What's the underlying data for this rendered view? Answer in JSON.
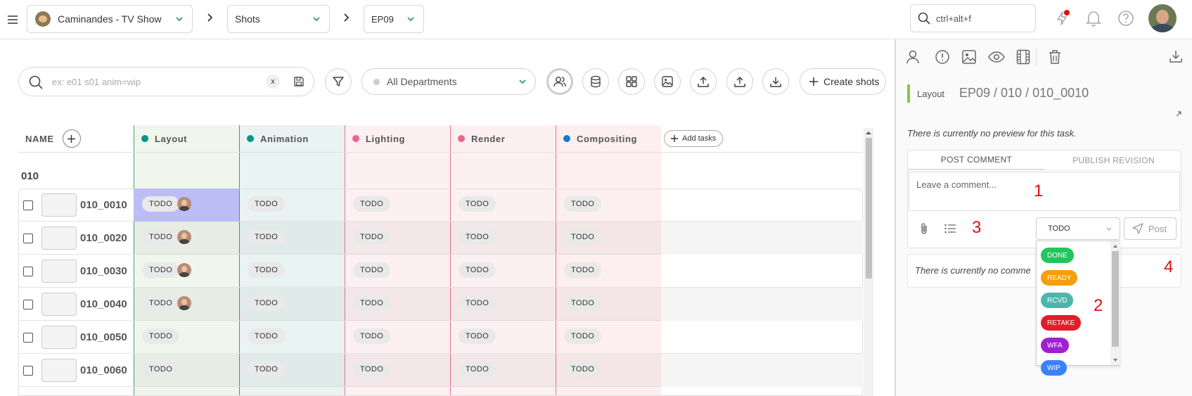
{
  "topbar": {
    "production": "Caminandes - TV Show",
    "section": "Shots",
    "episode": "EP09",
    "search_placeholder": "ctrl+alt+f"
  },
  "toolbar": {
    "search_placeholder": "ex: e01 s01 anim=wip",
    "clear_label": "x",
    "department": "All Departments",
    "create_label": "Create shots"
  },
  "table": {
    "name_header": "NAME",
    "columns": [
      {
        "label": "Layout",
        "color": "#009688"
      },
      {
        "label": "Animation",
        "color": "#009688"
      },
      {
        "label": "Lighting",
        "color": "#f06292"
      },
      {
        "label": "Render",
        "color": "#f06292"
      },
      {
        "label": "Compositing",
        "color": "#1976d2"
      }
    ],
    "add_tasks_label": "Add tasks",
    "sequence": "010",
    "rows": [
      {
        "name": "010_0010",
        "statuses": [
          "TODO",
          "TODO",
          "TODO",
          "TODO",
          "TODO"
        ]
      },
      {
        "name": "010_0020",
        "statuses": [
          "TODO",
          "TODO",
          "TODO",
          "TODO",
          "TODO"
        ]
      },
      {
        "name": "010_0030",
        "statuses": [
          "TODO",
          "TODO",
          "TODO",
          "TODO",
          "TODO"
        ]
      },
      {
        "name": "010_0040",
        "statuses": [
          "TODO",
          "TODO",
          "TODO",
          "TODO",
          "TODO"
        ]
      },
      {
        "name": "010_0050",
        "statuses": [
          "TODO",
          "TODO",
          "TODO",
          "TODO",
          "TODO"
        ]
      },
      {
        "name": "010_0060",
        "statuses": [
          "TODO",
          "TODO",
          "TODO",
          "TODO",
          "TODO"
        ]
      }
    ]
  },
  "panel": {
    "task_type": "Layout",
    "task_path": "EP09 / 010 / 010_0010",
    "no_preview": "There is currently no preview for this task.",
    "tab_post": "POST COMMENT",
    "tab_publish": "PUBLISH REVISION",
    "comment_placeholder": "Leave a comment...",
    "current_status": "TODO",
    "post_label": "Post",
    "no_comment": "There is currently no comme",
    "status_options": [
      {
        "label": "DONE",
        "color": "#22c55e"
      },
      {
        "label": "READY",
        "color": "#f59e0b"
      },
      {
        "label": "RCVD",
        "color": "#4db6ac"
      },
      {
        "label": "RETAKE",
        "color": "#e11d2a"
      },
      {
        "label": "WFA",
        "color": "#a020d0"
      },
      {
        "label": "WIP",
        "color": "#3b82f6"
      }
    ],
    "annotations": [
      "1",
      "2",
      "3",
      "4"
    ]
  }
}
